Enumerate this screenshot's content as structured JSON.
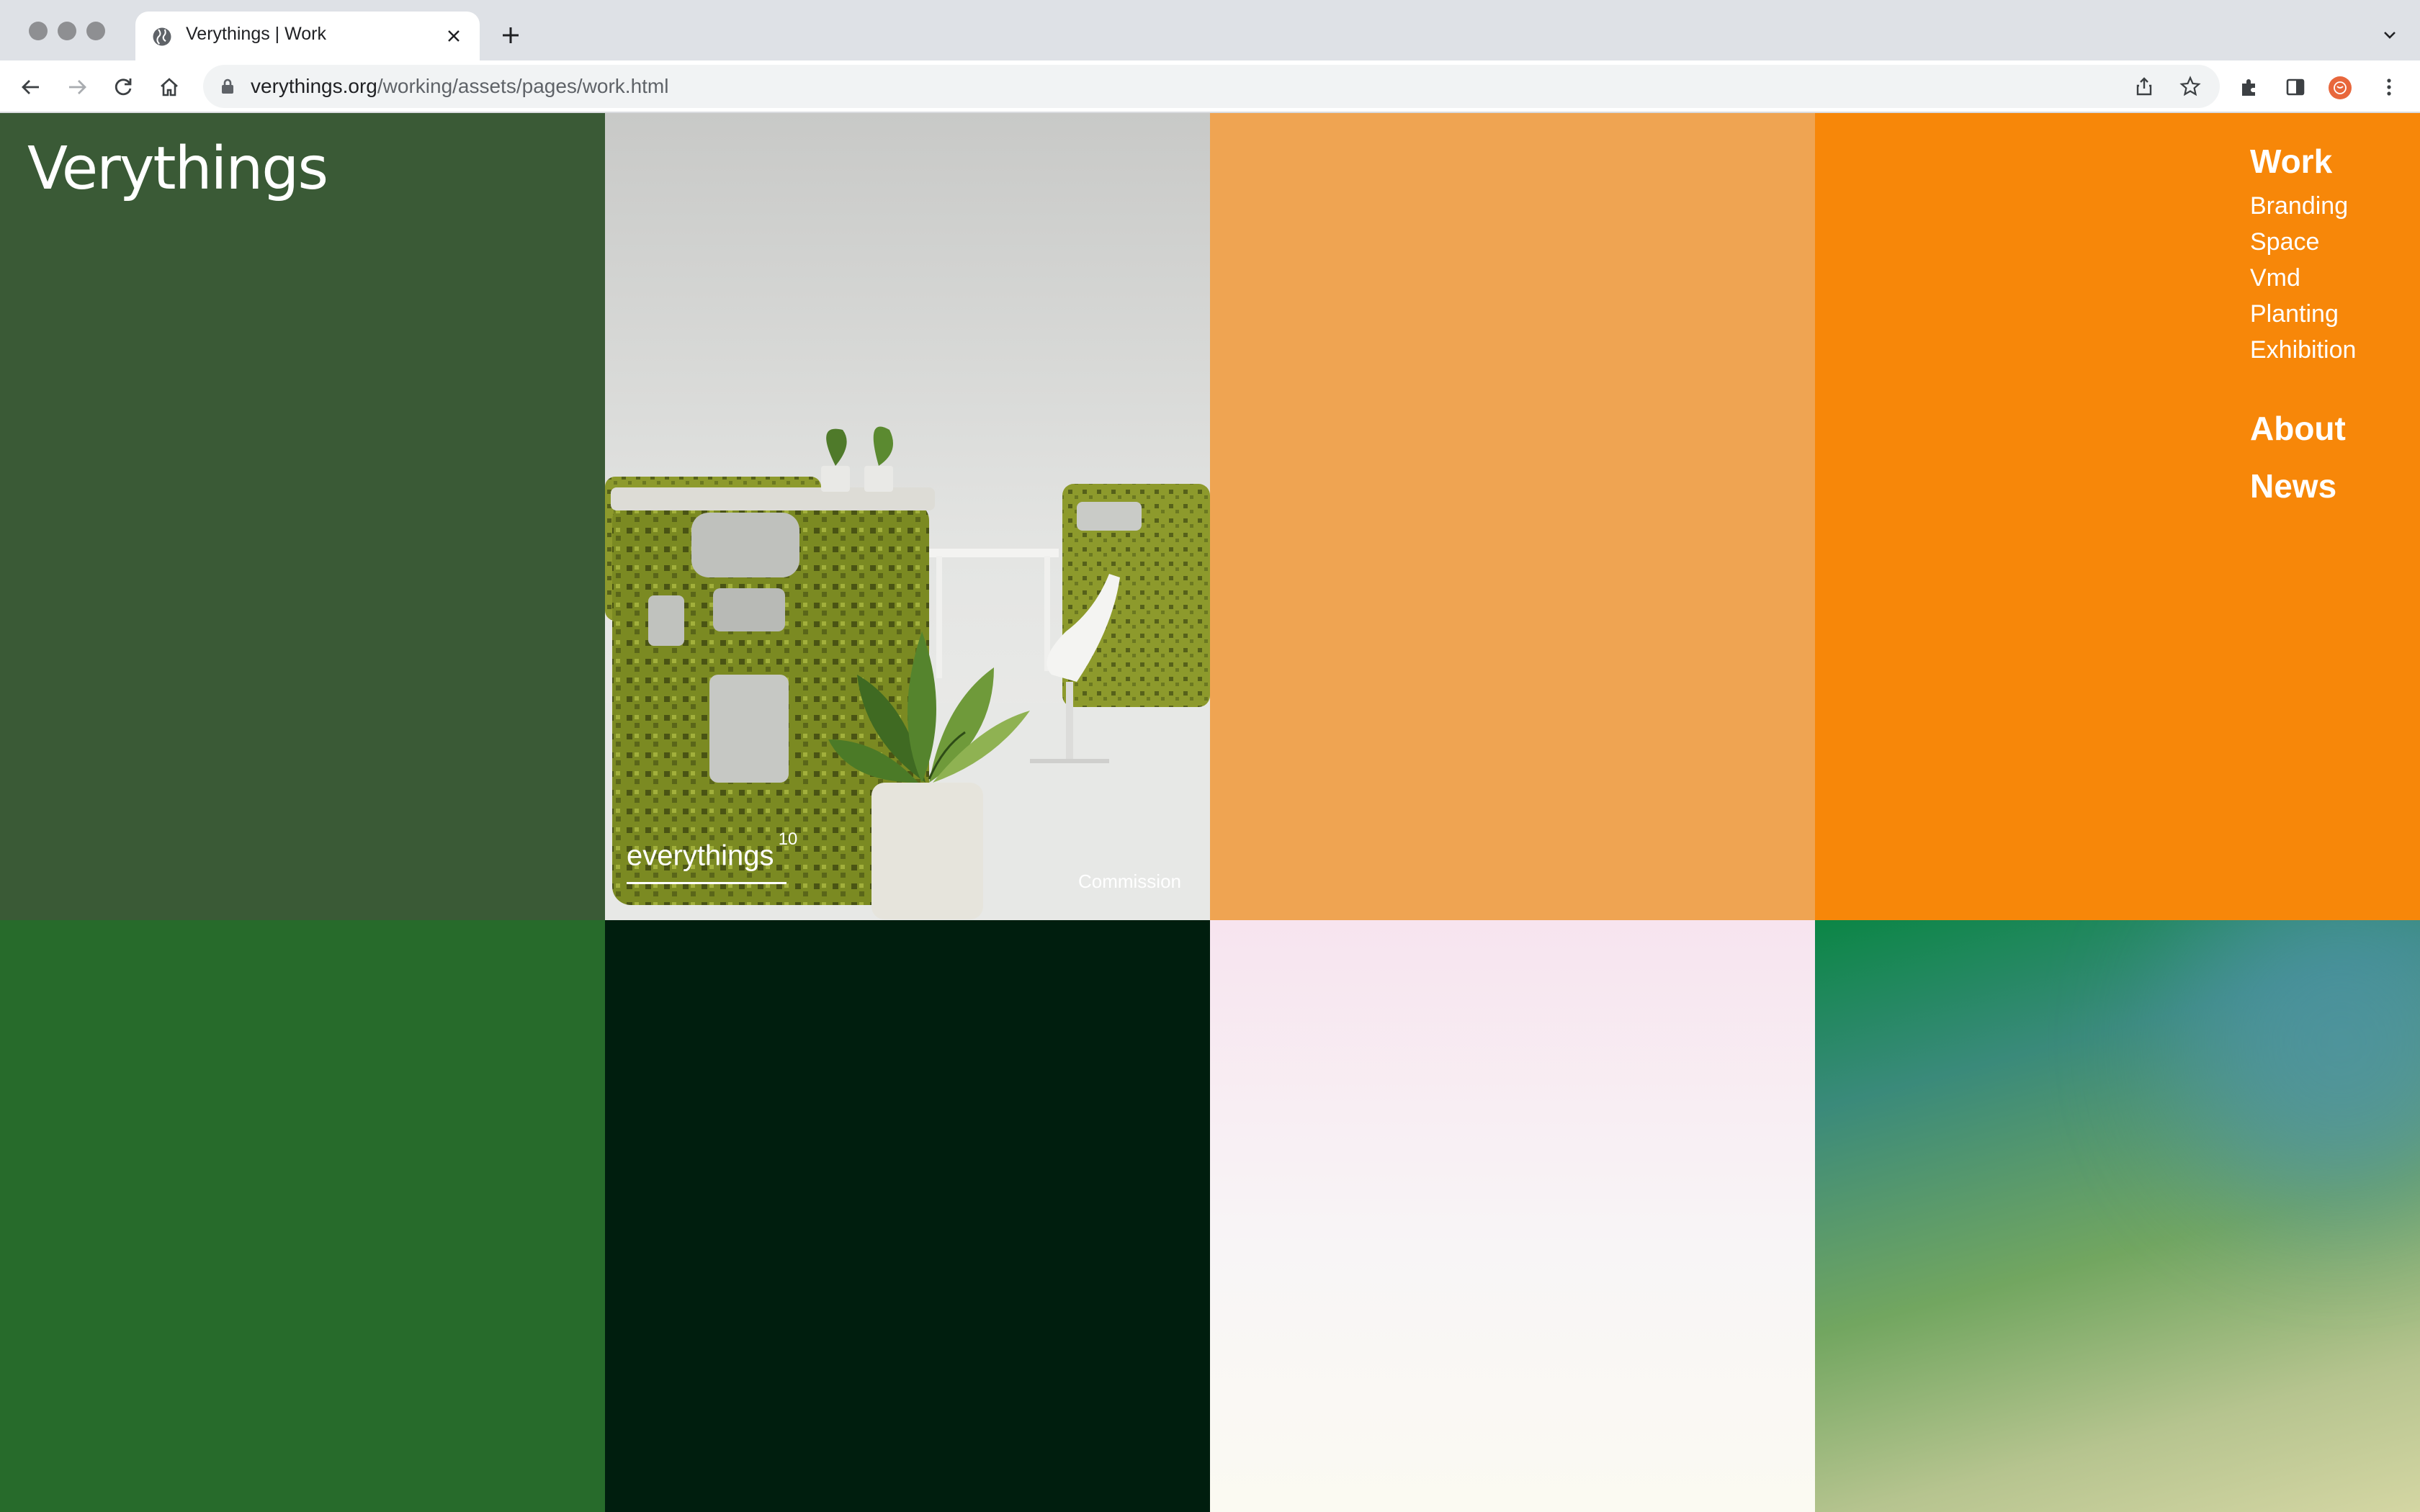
{
  "browser": {
    "tab_title": "Verythings | Work",
    "url_host": "verythings.org",
    "url_path": "/working/assets/pages/work.html",
    "icons": [
      "back-icon",
      "forward-icon",
      "reload-icon",
      "home-icon",
      "lock-icon",
      "share-icon",
      "star-icon",
      "extensions-icon",
      "sidepanel-icon",
      "profile-avatar",
      "menu-icon"
    ]
  },
  "site": {
    "logo": "Verythings",
    "nav": {
      "work": "Work",
      "sub": [
        "Branding",
        "Space",
        "Vmd",
        "Planting",
        "Exhibition"
      ],
      "about": "About",
      "news": "News"
    }
  },
  "grid": {
    "colors": {
      "tile_1": "#3a5a36",
      "tile_3": "#efa452",
      "tile_4": "#f78709",
      "tile_5": "#276b2b",
      "tile_6": "#001e0e",
      "tile_7_top": "#f7e4ef",
      "tile_7_bottom": "#fbfaf2",
      "tile_8_top": "#0b8645",
      "tile_8_bottom": "#d4d6a3"
    },
    "feature": {
      "title": "everythings",
      "number": "10",
      "label": "Commission"
    }
  }
}
